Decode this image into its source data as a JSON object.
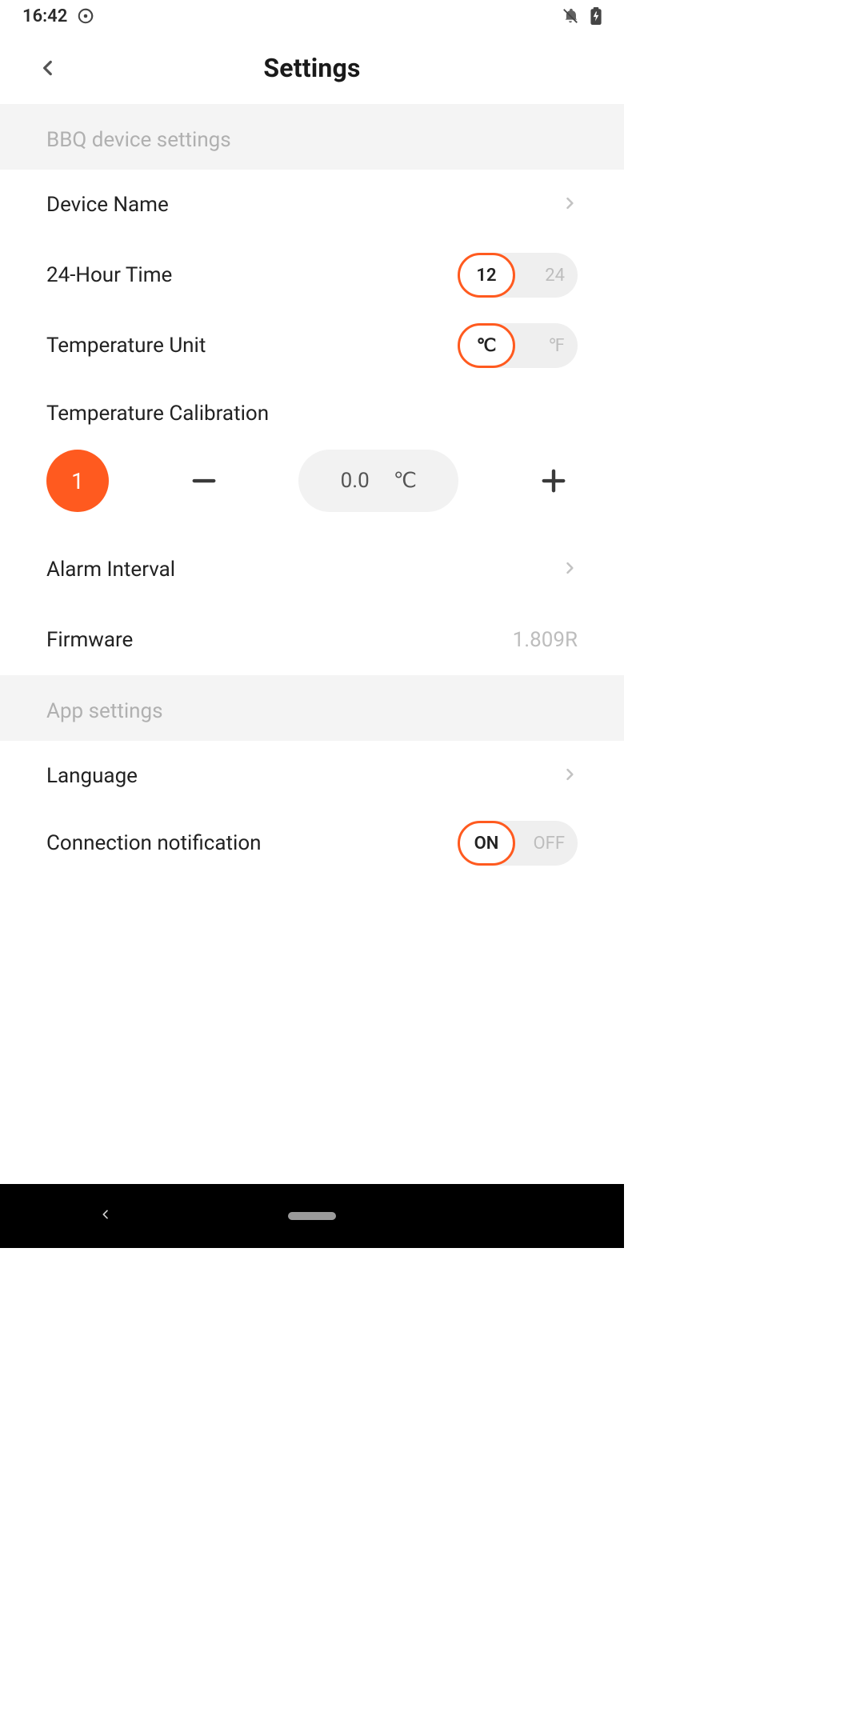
{
  "status": {
    "time": "16:42"
  },
  "header": {
    "title": "Settings"
  },
  "sections": {
    "bbq": {
      "title": "BBQ device settings",
      "device_name_label": "Device Name",
      "time_label": "24-Hour Time",
      "time_selected": "12",
      "time_other": "24",
      "temp_unit_label": "Temperature Unit",
      "temp_unit_selected": "℃",
      "temp_unit_other": "℉",
      "calib_label": "Temperature Calibration",
      "probe": "1",
      "calib_value": "0.0",
      "calib_unit": "℃",
      "alarm_label": "Alarm Interval",
      "firmware_label": "Firmware",
      "firmware_value": "1.809R"
    },
    "app": {
      "title": "App settings",
      "language_label": "Language",
      "conn_label": "Connection notification",
      "conn_selected": "ON",
      "conn_other": "OFF"
    }
  }
}
